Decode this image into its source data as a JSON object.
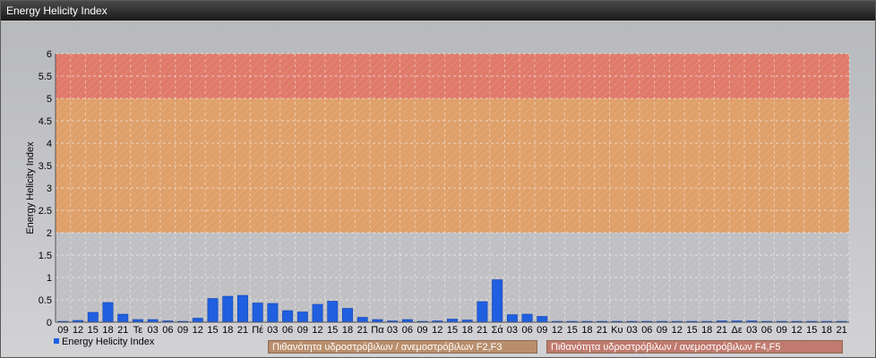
{
  "window": {
    "title": "Energy Helicity Index"
  },
  "zones": [
    {
      "from": 0,
      "to": 2,
      "color": "#c0c0c4"
    },
    {
      "from": 2,
      "to": 5,
      "color": "#dfa06a"
    },
    {
      "from": 5,
      "to": 6,
      "color": "#e07a6a"
    }
  ],
  "zone_legend": [
    {
      "label": "Πιθανότητα υδροστρόβιλων / ανεμοστρόβιλων F2,F3",
      "color": "#b98e6c"
    },
    {
      "label": "Πιθανότητα υδροστρόβιλων / ανεμοστρόβιλων F4,F5",
      "color": "#c07a6e"
    }
  ],
  "chart_data": {
    "type": "bar",
    "title": "",
    "xlabel": "",
    "ylabel": "Energy Helicity Index",
    "ylim": [
      0,
      6
    ],
    "yticks": [
      "0",
      "0.5",
      "1",
      "1.5",
      "2",
      "2.5",
      "3",
      "3.5",
      "4",
      "4.5",
      "5",
      "5.5",
      "6"
    ],
    "grid": true,
    "legend_position": "bottom-left",
    "categories": [
      "09",
      "12",
      "15",
      "18",
      "21",
      "Τε",
      "03",
      "06",
      "09",
      "12",
      "15",
      "18",
      "21",
      "Πέ",
      "03",
      "06",
      "09",
      "12",
      "15",
      "18",
      "21",
      "Πα",
      "03",
      "06",
      "09",
      "12",
      "15",
      "18",
      "21",
      "Σά",
      "03",
      "06",
      "09",
      "12",
      "15",
      "18",
      "21",
      "Κυ",
      "03",
      "06",
      "09",
      "12",
      "15",
      "18",
      "21",
      "Δε",
      "03",
      "06",
      "09",
      "12",
      "15",
      "18",
      "21"
    ],
    "series": [
      {
        "name": "Energy Helicity Index",
        "color": "#1f5fe0",
        "values": [
          0.02,
          0.04,
          0.22,
          0.44,
          0.18,
          0.06,
          0.06,
          0.03,
          0.02,
          0.09,
          0.53,
          0.58,
          0.6,
          0.43,
          0.42,
          0.26,
          0.23,
          0.4,
          0.47,
          0.31,
          0.11,
          0.06,
          0.03,
          0.06,
          0.02,
          0.03,
          0.07,
          0.05,
          0.46,
          0.95,
          0.17,
          0.18,
          0.13,
          0.02,
          0.02,
          0.02,
          0.02,
          0.02,
          0.02,
          0.02,
          0.02,
          0.02,
          0.02,
          0.02,
          0.03,
          0.03,
          0.03,
          0.02,
          0.02,
          0.02,
          0.02,
          0.02,
          0.02
        ]
      }
    ]
  }
}
